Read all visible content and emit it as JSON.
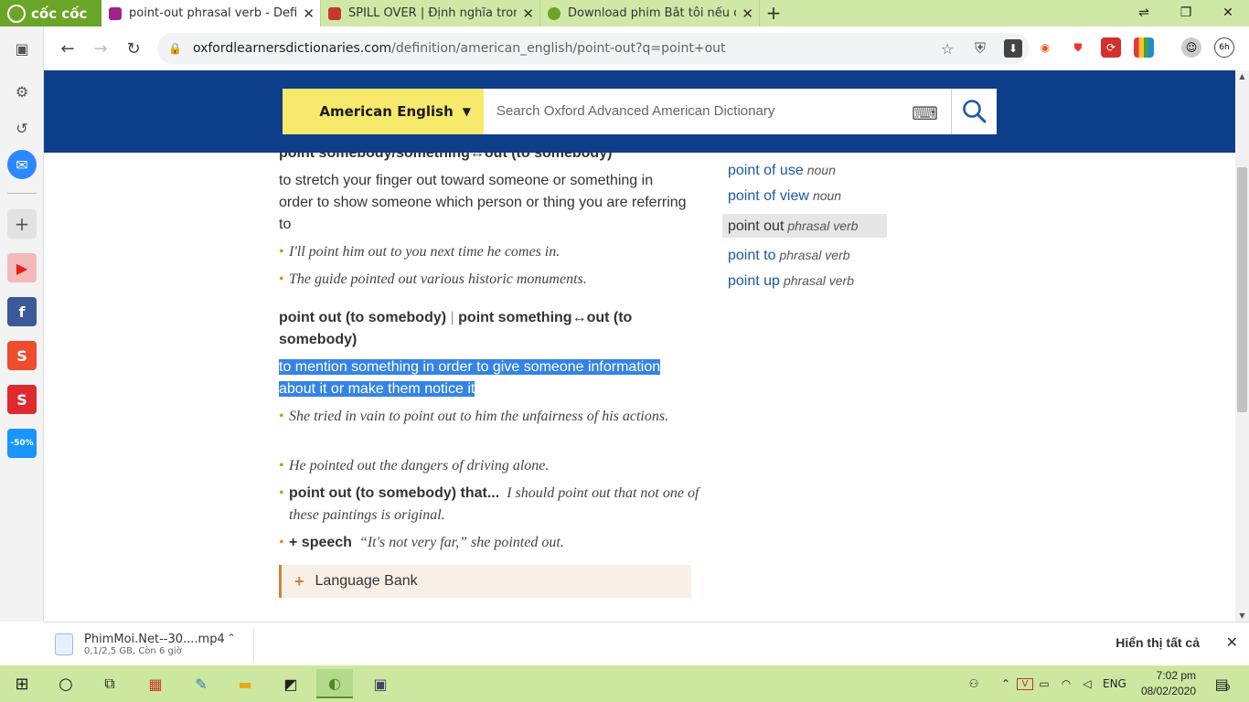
{
  "browser": {
    "brand": "cốc cốc",
    "tabs": [
      {
        "title": "point-out phrasal verb - Defin",
        "active": true,
        "favicon_color": "#a0228c"
      },
      {
        "title": "SPILL OVER | Định nghĩa trong",
        "active": false,
        "favicon_color": "#c8372d"
      },
      {
        "title": "Download phim Bắt tôi nếu c",
        "active": false,
        "favicon_color": "#6aa527"
      }
    ],
    "window_controls": [
      "restore-icon",
      "maximize-icon",
      "close-icon"
    ],
    "url_domain": "oxfordlearnersdictionaries.com",
    "url_path": "/definition/american_english/point-out?q=point+out",
    "profile_badge": "6h"
  },
  "search": {
    "dictionary": "American English",
    "placeholder": "Search Oxford Advanced American Dictionary"
  },
  "entry": {
    "cut_headline": "point somebody/something↔out (to somebody)",
    "def1": "to stretch your finger out toward someone or something in order to show someone which person or thing you are referring to",
    "ex1": "I'll point him out to you next time he comes in.",
    "ex2": "The guide pointed out various historic monuments.",
    "head2a": "point out (to somebody)",
    "head2sep": "|",
    "head2b": "point something↔out (to somebody)",
    "def2": "to mention something in order to give someone information about it or make them notice it",
    "ex3": "She tried in vain to point out to him the unfairness of his actions.",
    "ex4": "He pointed out the dangers of driving alone.",
    "ex5_label": "point out (to somebody) that...",
    "ex5": "I should point out that not one of these paintings is original.",
    "ex6_label": "+ speech",
    "ex6": "“It's not very far,” she pointed out.",
    "language_bank": "Language Bank"
  },
  "related": [
    {
      "word": "point of use",
      "pos": "noun",
      "active": false
    },
    {
      "word": "point of view",
      "pos": "noun",
      "active": false
    },
    {
      "word": "point out",
      "pos": "phrasal verb",
      "active": true
    },
    {
      "word": "point to",
      "pos": "phrasal verb",
      "active": false
    },
    {
      "word": "point up",
      "pos": "phrasal verb",
      "active": false
    }
  ],
  "download": {
    "filename": "PhimMoi.Net--30....mp4",
    "status": "0,1/2,5 GB, Còn 6 giờ",
    "show_all": "Hiển thị tất cả"
  },
  "taskbar": {
    "language": "ENG",
    "time": "7:02 pm",
    "date": "08/02/2020",
    "notifications": "9"
  }
}
